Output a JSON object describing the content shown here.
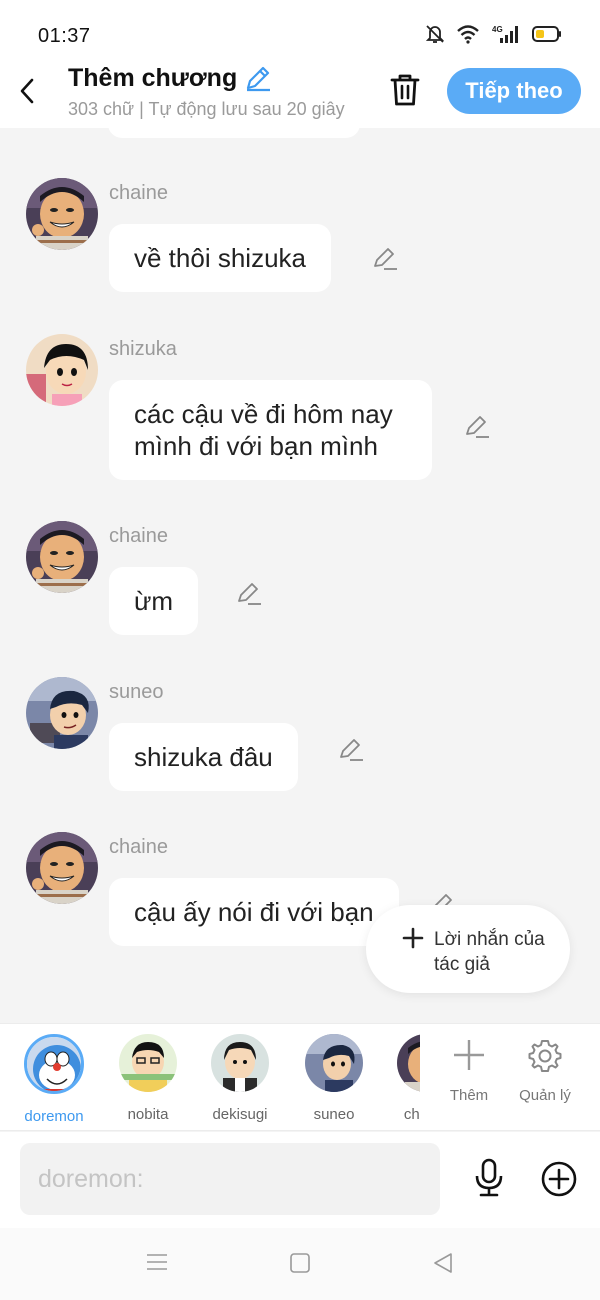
{
  "status_bar": {
    "time": "01:37",
    "network": "4G"
  },
  "header": {
    "title": "Thêm chương",
    "subtitle": "303 chữ | Tự động lưu sau 20 giây",
    "next_label": "Tiếp theo"
  },
  "messages": [
    {
      "sender": "chaine",
      "text": "về thôi shizuka"
    },
    {
      "sender": "shizuka",
      "text": "các cậu về đi hôm nay mình đi với bạn mình"
    },
    {
      "sender": "chaine",
      "text": "ừm"
    },
    {
      "sender": "suneo",
      "text": "shizuka đâu"
    },
    {
      "sender": "chaine",
      "text": "cậu ấy nói đi với bạn"
    }
  ],
  "author_note": {
    "label": "Lời nhắn của tác giả"
  },
  "characters": [
    {
      "name": "doremon",
      "selected": true
    },
    {
      "name": "nobita",
      "selected": false
    },
    {
      "name": "dekisugi",
      "selected": false
    },
    {
      "name": "suneo",
      "selected": false
    },
    {
      "name": "chaine",
      "selected": false
    }
  ],
  "tools": {
    "add_label": "Thêm",
    "manage_label": "Quản lý"
  },
  "composer": {
    "placeholder": "doremon:"
  },
  "colors": {
    "accent": "#5aabf6",
    "accent_text": "#3d99ef",
    "background": "#f4f4f4"
  },
  "icons": [
    "back-icon",
    "pencil-icon",
    "trash-icon",
    "plus-icon",
    "gear-icon",
    "microphone-icon",
    "add-circle-icon",
    "menu-icon",
    "home-square-icon",
    "back-triangle-icon"
  ]
}
